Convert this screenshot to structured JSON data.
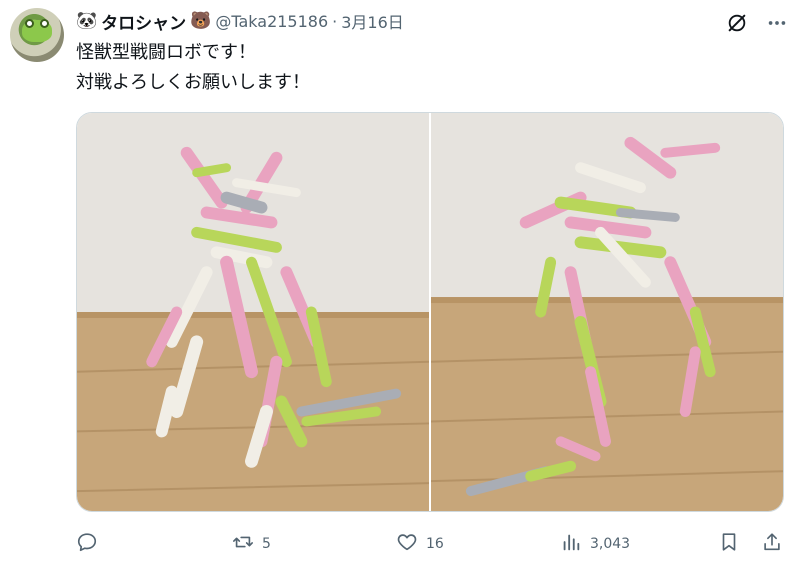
{
  "author": {
    "name": "タロシャン",
    "leading_emoji": "🐼",
    "trailing_emoji": "🐻",
    "handle": "@Taka215186",
    "separator": "·",
    "date": "3月16日"
  },
  "tweet": {
    "line1": "怪獣型戦闘ロボです！",
    "line2": "対戦よろしくお願いします！"
  },
  "media": {
    "images": [
      {
        "subject": "clothespin-robot-front"
      },
      {
        "subject": "clothespin-robot-side"
      }
    ]
  },
  "actions": {
    "reply": {
      "icon": "reply-icon",
      "count": ""
    },
    "retweet": {
      "icon": "retweet-icon",
      "count": "5"
    },
    "like": {
      "icon": "heart-icon",
      "count": "16"
    },
    "views": {
      "icon": "views-icon",
      "count": "3,043"
    },
    "bookmark": {
      "icon": "bookmark-icon"
    },
    "share": {
      "icon": "share-icon"
    }
  },
  "colors": {
    "text_primary": "#0f1419",
    "text_secondary": "#536471",
    "pin_pink": "#e9a3c0",
    "pin_green": "#b8d65a",
    "pin_white": "#f1eee6",
    "pin_gray": "#a9adb5",
    "wood": "#c7a67a",
    "wall": "#e6e3de"
  }
}
